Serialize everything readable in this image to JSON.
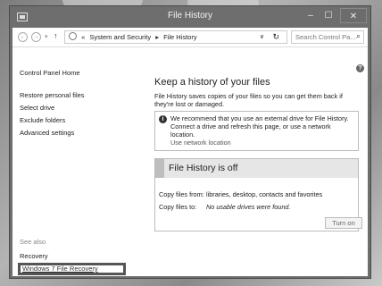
{
  "window": {
    "title": "File History",
    "controls": {
      "minimize": "–",
      "maximize": "☐",
      "close": "✕"
    }
  },
  "addressbar": {
    "back_glyph": "←",
    "forward_glyph": "→",
    "dropdown_glyph": "▾",
    "up_glyph": "↑",
    "crumbs": [
      "«",
      "System and Security",
      "▸",
      "File History"
    ],
    "crumb_dropdown": "∨",
    "refresh_glyph": "↻",
    "search_placeholder": "Search Control Pa...",
    "search_glyph": "⌕"
  },
  "sidebar": {
    "home": "Control Panel Home",
    "items": [
      "Restore personal files",
      "Select drive",
      "Exclude folders",
      "Advanced settings"
    ],
    "see_also_label": "See also",
    "see_also_items": [
      "Recovery",
      "Windows 7 File Recovery"
    ]
  },
  "main": {
    "help_glyph": "?",
    "heading": "Keep a history of your files",
    "description": "File History saves copies of your files so you can get them back if they're lost or damaged.",
    "notice": {
      "icon_glyph": "i",
      "text": "We recommend that you use an external drive for File History. Connect a drive and refresh this page, or use a network location.",
      "link": "Use network location"
    },
    "status": {
      "title": "File History is off",
      "rows": [
        {
          "label": "Copy files from:",
          "value": "libraries, desktop, contacts and favorites"
        },
        {
          "label": "Copy files to:",
          "value": "No usable drives were found."
        }
      ]
    },
    "turn_on_label": "Turn on"
  }
}
